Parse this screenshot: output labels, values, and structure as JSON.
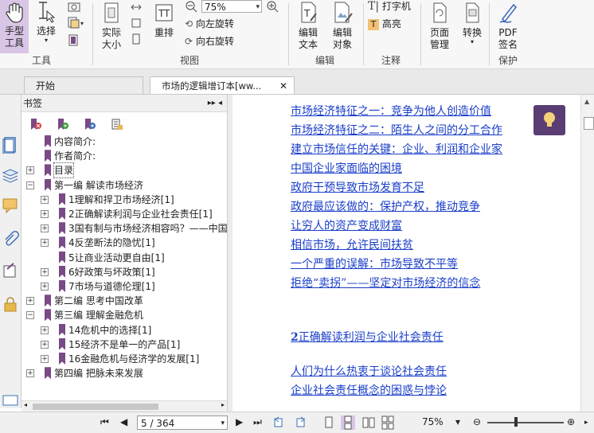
{
  "ribbon": {
    "hand_tool": "手型\n工具",
    "select": "选择",
    "group_tools": "工具",
    "actual_size": "实际\n大小",
    "reflow": "重排",
    "zoom_value": "75%",
    "rotate_left": "向左旋转",
    "rotate_right": "向右旋转",
    "group_view": "视图",
    "edit_text": "编辑\n文本",
    "edit_object": "编辑\n对象",
    "group_edit": "编辑",
    "typewriter": "打字机",
    "highlight": "高亮",
    "group_comment": "注释",
    "page_manage": "页面\n管理",
    "convert": "转换",
    "pdf_sign": "PDF\n签名",
    "group_protect": "保护"
  },
  "tabs": {
    "home": "开始",
    "doc": "市场的逻辑增订本[ww...",
    "close": "✕"
  },
  "bookmarks": {
    "header": "书签",
    "collapse": "▸▸ ◂",
    "items": [
      {
        "text": "内容简介:",
        "level": 0,
        "expander": ""
      },
      {
        "text": "作者简介:",
        "level": 0,
        "expander": ""
      },
      {
        "text": "目录",
        "level": 0,
        "expander": "+"
      },
      {
        "text": "第一编 解读市场经济",
        "level": 0,
        "expander": "−"
      },
      {
        "text": "1理解和捍卫市场经济[1]",
        "level": 1,
        "expander": "+"
      },
      {
        "text": "2正确解读利润与企业社会责任[1]",
        "level": 1,
        "expander": "+"
      },
      {
        "text": "3国有制与市场经济相容吗？——中国",
        "level": 1,
        "expander": "+"
      },
      {
        "text": "4反垄断法的隐忧[1]",
        "level": 1,
        "expander": "+"
      },
      {
        "text": "5让商业活动更自由[1]",
        "level": 1,
        "expander": ""
      },
      {
        "text": "6好政策与坏政策[1]",
        "level": 1,
        "expander": "+"
      },
      {
        "text": "7市场与道德伦理[1]",
        "level": 1,
        "expander": "+"
      },
      {
        "text": "第二编 思考中国改革",
        "level": 0,
        "expander": "+"
      },
      {
        "text": "第三编 理解金融危机",
        "level": 0,
        "expander": "−"
      },
      {
        "text": "14危机中的选择[1]",
        "level": 1,
        "expander": "+"
      },
      {
        "text": "15经济不是单一的产品[1]",
        "level": 1,
        "expander": "+"
      },
      {
        "text": "16金融危机与经济学的发展[1]",
        "level": 1,
        "expander": "+"
      },
      {
        "text": "第四编 把脉未来发展",
        "level": 0,
        "expander": "+"
      }
    ]
  },
  "document": {
    "lines": [
      "市场经济特征之一：竞争为他人创造价值",
      "市场经济特征之二：陌生人之间的分工合作",
      "建立市场信任的关键：企业、利润和企业家",
      "中国企业家面临的困境",
      "政府干预导致市场发育不足",
      "政府最应该做的：保护产权，推动竞争",
      "让穷人的资产变成财富",
      "相信市场，允许民间扶贫",
      "一个严重的误解：市场导致不平等",
      "拒绝“卖拐”——坚定对市场经济的信念"
    ],
    "chapter_num": "2",
    "chapter_title": "正确解读利润与企业社会责任",
    "lines2": [
      "人们为什么热衷于谈论社会责任",
      "企业社会责任概念的困惑与悖论"
    ]
  },
  "status": {
    "page": "5 / 364",
    "zoom": "75%"
  }
}
